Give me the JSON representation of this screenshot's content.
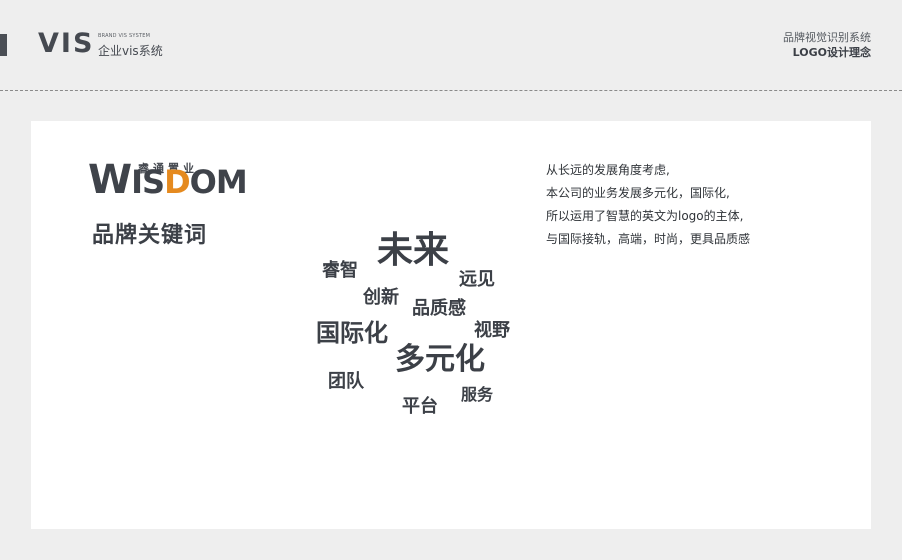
{
  "header": {
    "brand_mark": "VIS",
    "brand_sub_en": "BRAND VIS SYSTEM",
    "brand_sub_cn": "企业vis系统",
    "right_line1": "品牌视觉识别系统",
    "right_line2": "LOGO设计理念"
  },
  "logo": {
    "cn_text": "睿通置业",
    "word_w": "W",
    "word_is": "IS",
    "word_o": "D",
    "word_om": "OM"
  },
  "left": {
    "title": "品牌关键词"
  },
  "keywords": [
    "未来",
    "睿智",
    "远见",
    "创新",
    "品质感",
    "视野",
    "国际化",
    "多元化",
    "团队",
    "服务",
    "平台"
  ],
  "description": [
    "从长远的发展角度考虑,",
    "本公司的业务发展多元化，国际化,",
    "所以运用了智慧的英文为logo的主体,",
    "与国际接轨，高端，时尚，更具品质感"
  ],
  "colors": {
    "background": "#eeeeee",
    "card": "#ffffff",
    "text": "#3c4047",
    "accent": "#e58a1f"
  }
}
